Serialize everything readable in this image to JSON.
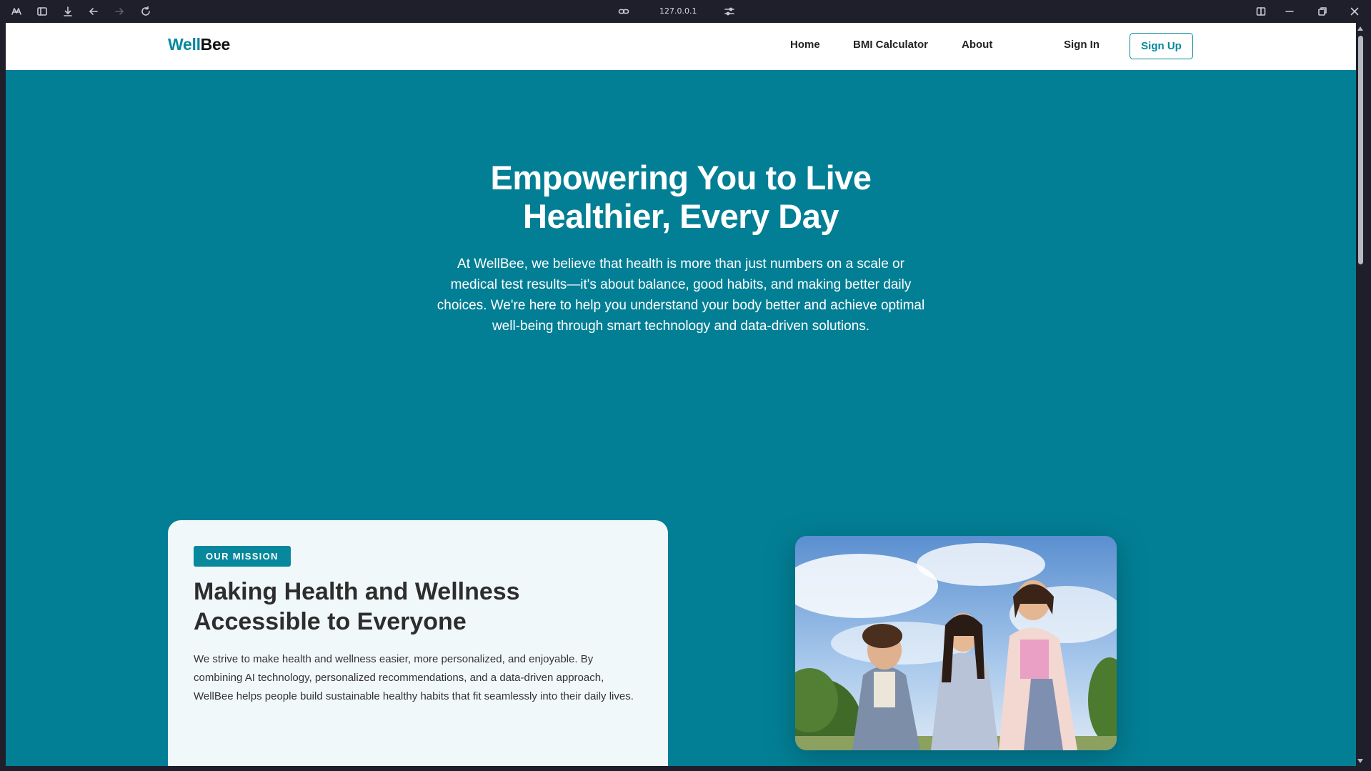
{
  "browser": {
    "url": "127.0.0.1"
  },
  "navbar": {
    "logo_part1": "Well",
    "logo_part2": "Bee",
    "links": [
      "Home",
      "BMI Calculator",
      "About"
    ],
    "signin": "Sign In",
    "signup": "Sign Up"
  },
  "hero": {
    "title_line1": "Empowering You to Live",
    "title_line2": "Healthier, Every Day",
    "text": "At WellBee, we believe that health is more than just numbers on a scale or medical test results—it's about balance, good habits, and making better daily choices. We're here to help you understand your body better and achieve optimal well-being through smart technology and data-driven solutions."
  },
  "mission": {
    "badge": "OUR MISSION",
    "title": "Making Health and Wellness Accessible to Everyone",
    "text": "We strive to make health and wellness easier, more personalized, and enjoyable. By combining AI technology, personalized recommendations, and a data-driven approach, WellBee helps people build sustainable healthy habits that fit seamlessly into their daily lives."
  },
  "colors": {
    "primary": "#07889c",
    "hero_bg": "#037f95",
    "card_bg": "#f1f8f9"
  }
}
